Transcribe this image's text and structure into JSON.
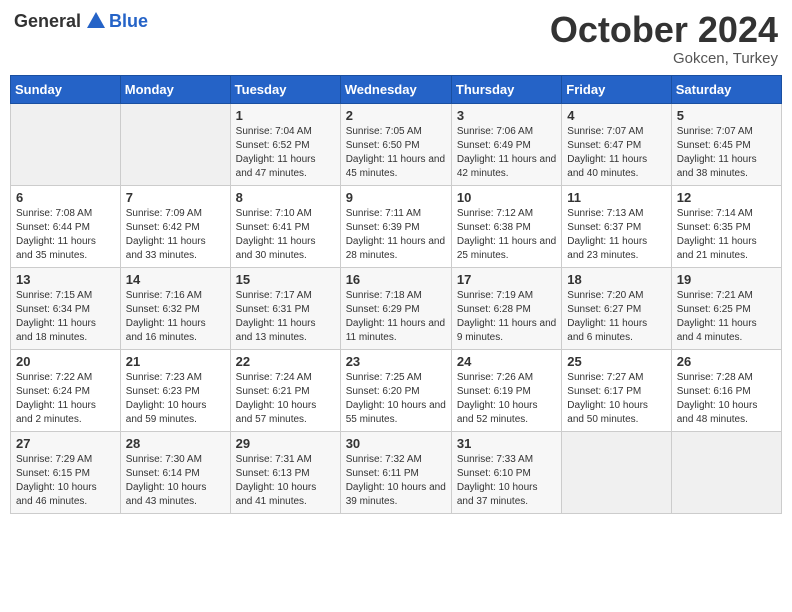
{
  "header": {
    "logo_general": "General",
    "logo_blue": "Blue",
    "month": "October 2024",
    "location": "Gokcen, Turkey"
  },
  "weekdays": [
    "Sunday",
    "Monday",
    "Tuesday",
    "Wednesday",
    "Thursday",
    "Friday",
    "Saturday"
  ],
  "weeks": [
    [
      {
        "day": "",
        "empty": true
      },
      {
        "day": "",
        "empty": true
      },
      {
        "day": "1",
        "sunrise": "7:04 AM",
        "sunset": "6:52 PM",
        "daylight": "11 hours and 47 minutes."
      },
      {
        "day": "2",
        "sunrise": "7:05 AM",
        "sunset": "6:50 PM",
        "daylight": "11 hours and 45 minutes."
      },
      {
        "day": "3",
        "sunrise": "7:06 AM",
        "sunset": "6:49 PM",
        "daylight": "11 hours and 42 minutes."
      },
      {
        "day": "4",
        "sunrise": "7:07 AM",
        "sunset": "6:47 PM",
        "daylight": "11 hours and 40 minutes."
      },
      {
        "day": "5",
        "sunrise": "7:07 AM",
        "sunset": "6:45 PM",
        "daylight": "11 hours and 38 minutes."
      }
    ],
    [
      {
        "day": "6",
        "sunrise": "7:08 AM",
        "sunset": "6:44 PM",
        "daylight": "11 hours and 35 minutes."
      },
      {
        "day": "7",
        "sunrise": "7:09 AM",
        "sunset": "6:42 PM",
        "daylight": "11 hours and 33 minutes."
      },
      {
        "day": "8",
        "sunrise": "7:10 AM",
        "sunset": "6:41 PM",
        "daylight": "11 hours and 30 minutes."
      },
      {
        "day": "9",
        "sunrise": "7:11 AM",
        "sunset": "6:39 PM",
        "daylight": "11 hours and 28 minutes."
      },
      {
        "day": "10",
        "sunrise": "7:12 AM",
        "sunset": "6:38 PM",
        "daylight": "11 hours and 25 minutes."
      },
      {
        "day": "11",
        "sunrise": "7:13 AM",
        "sunset": "6:37 PM",
        "daylight": "11 hours and 23 minutes."
      },
      {
        "day": "12",
        "sunrise": "7:14 AM",
        "sunset": "6:35 PM",
        "daylight": "11 hours and 21 minutes."
      }
    ],
    [
      {
        "day": "13",
        "sunrise": "7:15 AM",
        "sunset": "6:34 PM",
        "daylight": "11 hours and 18 minutes."
      },
      {
        "day": "14",
        "sunrise": "7:16 AM",
        "sunset": "6:32 PM",
        "daylight": "11 hours and 16 minutes."
      },
      {
        "day": "15",
        "sunrise": "7:17 AM",
        "sunset": "6:31 PM",
        "daylight": "11 hours and 13 minutes."
      },
      {
        "day": "16",
        "sunrise": "7:18 AM",
        "sunset": "6:29 PM",
        "daylight": "11 hours and 11 minutes."
      },
      {
        "day": "17",
        "sunrise": "7:19 AM",
        "sunset": "6:28 PM",
        "daylight": "11 hours and 9 minutes."
      },
      {
        "day": "18",
        "sunrise": "7:20 AM",
        "sunset": "6:27 PM",
        "daylight": "11 hours and 6 minutes."
      },
      {
        "day": "19",
        "sunrise": "7:21 AM",
        "sunset": "6:25 PM",
        "daylight": "11 hours and 4 minutes."
      }
    ],
    [
      {
        "day": "20",
        "sunrise": "7:22 AM",
        "sunset": "6:24 PM",
        "daylight": "11 hours and 2 minutes."
      },
      {
        "day": "21",
        "sunrise": "7:23 AM",
        "sunset": "6:23 PM",
        "daylight": "10 hours and 59 minutes."
      },
      {
        "day": "22",
        "sunrise": "7:24 AM",
        "sunset": "6:21 PM",
        "daylight": "10 hours and 57 minutes."
      },
      {
        "day": "23",
        "sunrise": "7:25 AM",
        "sunset": "6:20 PM",
        "daylight": "10 hours and 55 minutes."
      },
      {
        "day": "24",
        "sunrise": "7:26 AM",
        "sunset": "6:19 PM",
        "daylight": "10 hours and 52 minutes."
      },
      {
        "day": "25",
        "sunrise": "7:27 AM",
        "sunset": "6:17 PM",
        "daylight": "10 hours and 50 minutes."
      },
      {
        "day": "26",
        "sunrise": "7:28 AM",
        "sunset": "6:16 PM",
        "daylight": "10 hours and 48 minutes."
      }
    ],
    [
      {
        "day": "27",
        "sunrise": "7:29 AM",
        "sunset": "6:15 PM",
        "daylight": "10 hours and 46 minutes."
      },
      {
        "day": "28",
        "sunrise": "7:30 AM",
        "sunset": "6:14 PM",
        "daylight": "10 hours and 43 minutes."
      },
      {
        "day": "29",
        "sunrise": "7:31 AM",
        "sunset": "6:13 PM",
        "daylight": "10 hours and 41 minutes."
      },
      {
        "day": "30",
        "sunrise": "7:32 AM",
        "sunset": "6:11 PM",
        "daylight": "10 hours and 39 minutes."
      },
      {
        "day": "31",
        "sunrise": "7:33 AM",
        "sunset": "6:10 PM",
        "daylight": "10 hours and 37 minutes."
      },
      {
        "day": "",
        "empty": true
      },
      {
        "day": "",
        "empty": true
      }
    ]
  ]
}
